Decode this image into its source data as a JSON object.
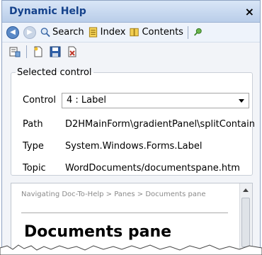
{
  "window": {
    "title": "Dynamic Help",
    "close_symbol": "×"
  },
  "toolbar": {
    "search": "Search",
    "index": "Index",
    "contents": "Contents"
  },
  "selected_control": {
    "legend": "Selected control",
    "control_label": "Control",
    "control_value": "4 : Label",
    "path_label": "Path",
    "path_value": "D2HMainForm\\gradientPanel\\splitContain",
    "type_label": "Type",
    "type_value": "System.Windows.Forms.Label",
    "topic_label": "Topic",
    "topic_value": "WordDocuments/documentspane.htm"
  },
  "help_pane": {
    "breadcrumb": "Navigating Doc-To-Help > Panes > Documents pane",
    "title": "Documents pane"
  },
  "colors": {
    "title_text": "#15428b",
    "title_bar": "#c9daf1"
  }
}
